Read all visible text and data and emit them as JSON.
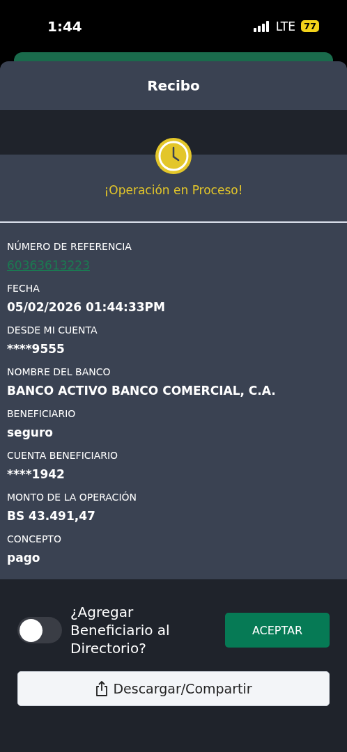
{
  "status_bar": {
    "time": "1:44",
    "network": "LTE",
    "battery": "77"
  },
  "header": {
    "title": "Recibo"
  },
  "status": {
    "message": "¡Operación en Proceso!"
  },
  "details": [
    {
      "label": "NÚMERO DE REFERENCIA",
      "value": "60363613223",
      "kind": "link"
    },
    {
      "label": "FECHA",
      "value": "05/02/2026 01:44:33PM",
      "kind": "text"
    },
    {
      "label": "DESDE MI CUENTA",
      "value": "****9555",
      "kind": "text"
    },
    {
      "label": "NOMBRE DEL BANCO",
      "value": "BANCO ACTIVO BANCO COMERCIAL, C.A.",
      "kind": "text"
    },
    {
      "label": "BENEFICIARIO",
      "value": "seguro",
      "kind": "text"
    },
    {
      "label": "CUENTA BENEFICIARIO",
      "value": "****1942",
      "kind": "text"
    },
    {
      "label": "MONTO DE LA OPERACIÓN",
      "value": "BS 43.491,47",
      "kind": "text"
    },
    {
      "label": "CONCEPTO",
      "value": "pago",
      "kind": "text"
    }
  ],
  "footer": {
    "toggle": {
      "label": "¿Agregar Beneficiario al Directorio?",
      "on": false
    },
    "accept_button": "ACEPTAR",
    "share_button": "Descargar/Compartir"
  }
}
